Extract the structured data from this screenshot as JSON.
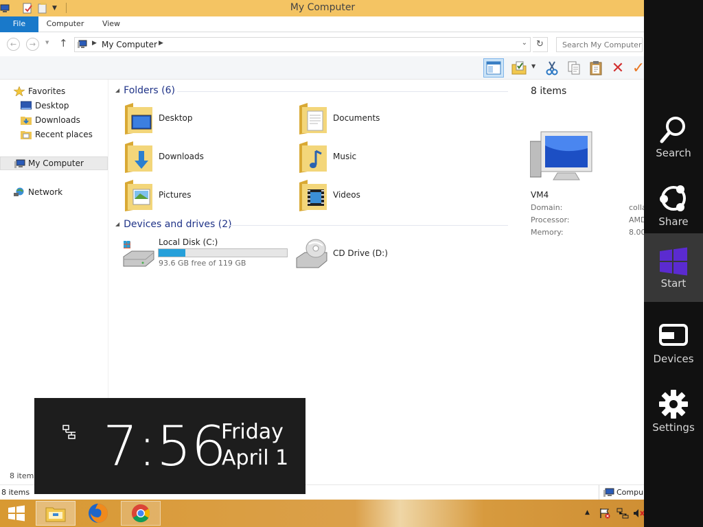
{
  "window": {
    "title": "My Computer"
  },
  "ribbon": {
    "tabs": {
      "file": "File",
      "computer": "Computer",
      "view": "View"
    }
  },
  "address": {
    "path": "My Computer",
    "search_placeholder": "Search My Computer"
  },
  "nav": {
    "favorites": "Favorites",
    "desktop": "Desktop",
    "downloads": "Downloads",
    "recent_places": "Recent places",
    "my_computer": "My Computer",
    "network": "Network"
  },
  "content": {
    "folders_header": "Folders (6)",
    "folders": {
      "desktop": "Desktop",
      "documents": "Documents",
      "downloads": "Downloads",
      "music": "Music",
      "pictures": "Pictures",
      "videos": "Videos"
    },
    "drives_header": "Devices and drives (2)",
    "drive_c": {
      "label": "Local Disk (C:)",
      "free_text": "93.6 GB free of 119 GB",
      "used_fraction": 0.21
    },
    "drive_d": {
      "label": "CD Drive (D:)"
    }
  },
  "details": {
    "count": "8 items",
    "name": "VM4",
    "domain_label": "Domain:",
    "domain_value": "colla",
    "processor_label": "Processor:",
    "processor_value": "AMD",
    "memory_label": "Memory:",
    "memory_value": "8.00"
  },
  "status": {
    "count_upper": "8 items",
    "count": "8 items",
    "computer": "Compu"
  },
  "clock": {
    "time": "7:56",
    "day": "Friday",
    "date": "April 1"
  },
  "charms": {
    "search": "Search",
    "share": "Share",
    "start": "Start",
    "devices": "Devices",
    "settings": "Settings"
  },
  "colors": {
    "titlebar": "#f4c463",
    "file_tab": "#1979ca",
    "charms_bg": "#111111",
    "start_highlight": "#5b2bd0",
    "drive_fill": "#26a0da",
    "group_header": "#1e3287"
  }
}
